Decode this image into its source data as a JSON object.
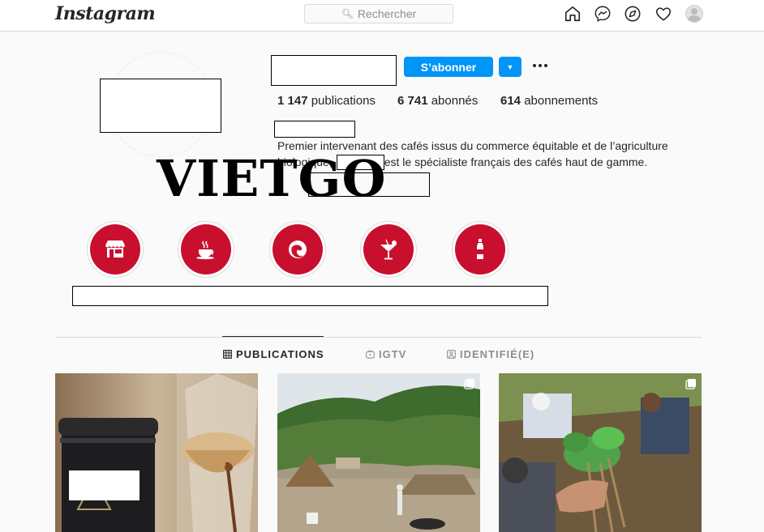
{
  "app": {
    "logo_text": "Instagram"
  },
  "search": {
    "placeholder": "Rechercher",
    "icon": "search-icon"
  },
  "nav": {
    "icons": [
      "home-icon",
      "messenger-icon",
      "explore-icon",
      "heart-icon",
      "avatar"
    ]
  },
  "profile": {
    "follow_label": "S’abonner",
    "stats": {
      "posts_count": "1 147",
      "posts_label": "publications",
      "followers_count": "6 741",
      "followers_label": "abonnés",
      "following_count": "614",
      "following_label": "abonnements"
    },
    "bio": {
      "line1": "Premier intervenant des cafés issus du commerce équitable et de l’agriculture",
      "line2_start": "biologique,",
      "line2_end": "est le spécialiste français des cafés haut de gamme."
    }
  },
  "watermark": {
    "text": "VIETGO"
  },
  "highlights": [
    {
      "icon": "storefront-icon"
    },
    {
      "icon": "coffee-cup-icon"
    },
    {
      "icon": "coffee-bean-icon"
    },
    {
      "icon": "cocktail-icon"
    },
    {
      "icon": "bottle-icon"
    }
  ],
  "tabs": [
    {
      "label": "PUBLICATIONS",
      "icon": "grid-icon",
      "active": true
    },
    {
      "label": "IGTV",
      "icon": "igtv-icon",
      "active": false
    },
    {
      "label": "IDENTIFIÉ(E)",
      "icon": "tagged-icon",
      "active": false
    }
  ],
  "colors": {
    "accent": "#0095f6",
    "highlight_red": "#c8102e",
    "text": "#262626",
    "muted": "#8e8e8e",
    "border": "#dbdbdb"
  }
}
